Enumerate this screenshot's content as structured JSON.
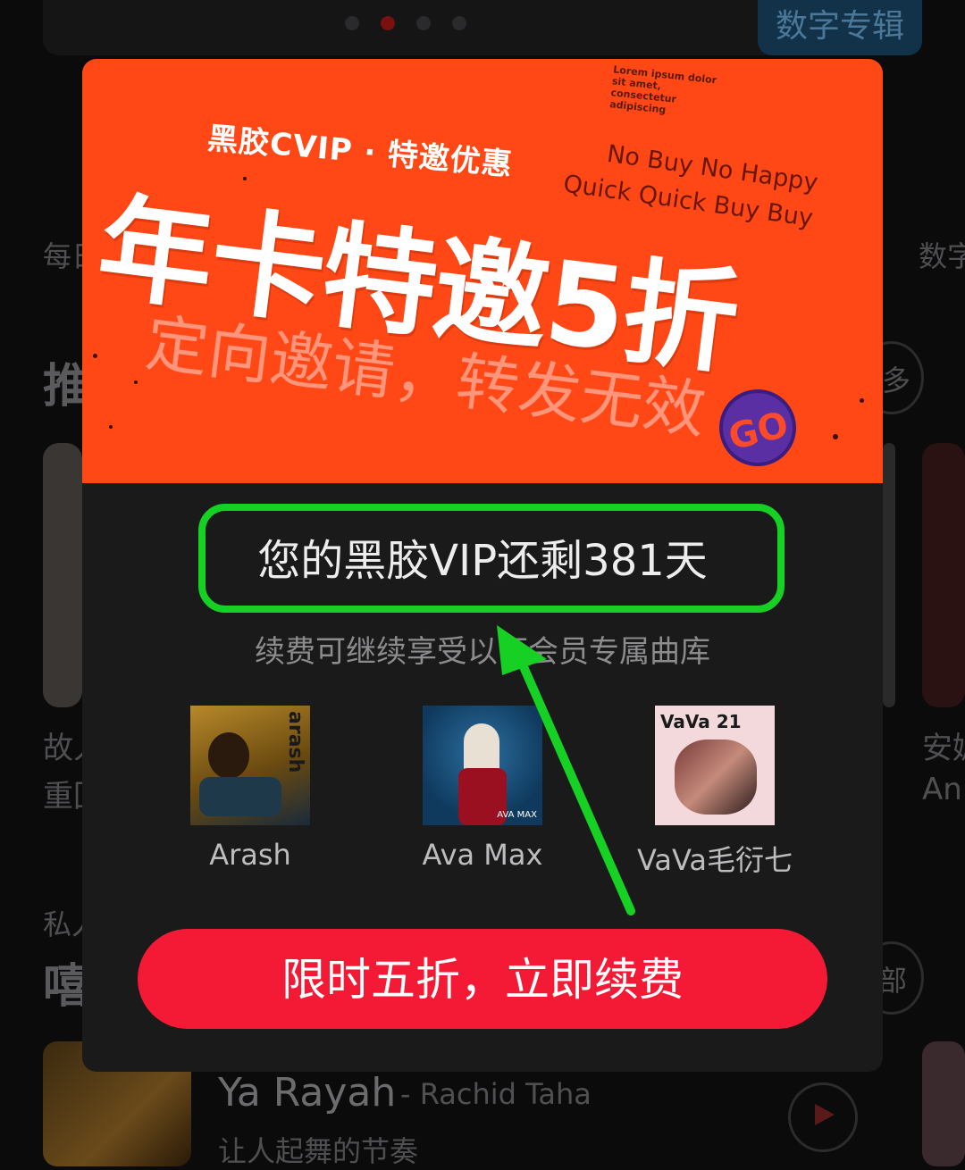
{
  "background": {
    "banner_tag": "数字专辑",
    "left_label_1": "每日",
    "right_label_1": "数字",
    "section_title_1": "推荐",
    "more_label_1": "多",
    "card_left_title": "故人",
    "card_left_sub": "重回",
    "card_right_title": "安妮",
    "card_right_sub": "An",
    "section_label_2": "私人",
    "section_title_2": "嘻哈",
    "more_label_2": "部",
    "song_title": "Ya Rayah",
    "song_artist": "- Rachid Taha",
    "song_desc": "让人起舞的节奏"
  },
  "promo": {
    "small_print": "Lorem ipsum dolor sit amet, consectetur adipiscing",
    "vip_line": "黑胶CVIP · 特邀优惠",
    "english_line_1": "No Buy No Happy",
    "english_line_2": "Quick Quick Buy Buy",
    "headline": "年卡特邀5折",
    "sub_line": "定向邀请，转发无效",
    "go_badge": "GO"
  },
  "modal": {
    "remaining_text": "您的黑胶VIP还剩381天",
    "remaining_note": "续费可继续享受以下会员专属曲库",
    "artists": [
      {
        "name": "Arash",
        "cover_text": "arash"
      },
      {
        "name": "Ava Max",
        "cover_text": "AVA MAX"
      },
      {
        "name": "VaVa毛衍七",
        "cover_text": "VaVa 21"
      }
    ],
    "renew_button": "限时五折，立即续费"
  },
  "colors": {
    "promo_bg": "#ff4816",
    "button_red": "#f41a35",
    "annotation_green": "#17d024",
    "modal_bg": "#1a1a1b"
  }
}
